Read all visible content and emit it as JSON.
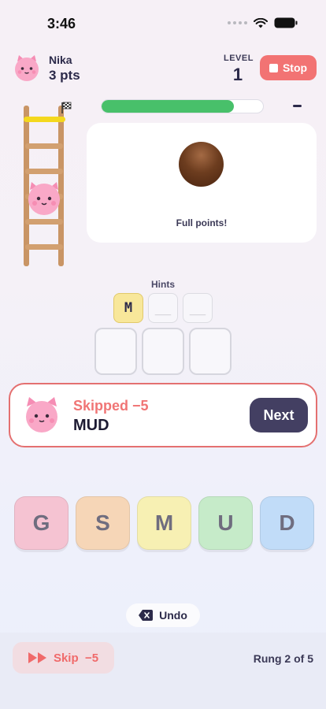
{
  "status_bar": {
    "time": "3:46"
  },
  "player": {
    "name": "Nika",
    "points": "3 pts"
  },
  "level": {
    "label": "LEVEL",
    "value": "1"
  },
  "stop_button": {
    "label": "Stop"
  },
  "progress": {
    "fraction": 0.82,
    "fill_color": "#48c06a"
  },
  "clue": {
    "text": "Full points!"
  },
  "hints": {
    "label": "Hints",
    "tiles": [
      {
        "char": "M",
        "revealed": true
      },
      {
        "char": "__",
        "revealed": false
      },
      {
        "char": "__",
        "revealed": false
      }
    ]
  },
  "answer_slots": 3,
  "result": {
    "title": "Skipped −5",
    "word": "MUD",
    "next_label": "Next"
  },
  "letters": [
    {
      "char": "G",
      "color": "#f5c3d2"
    },
    {
      "char": "S",
      "color": "#f6d6b7"
    },
    {
      "char": "M",
      "color": "#f7f0b3"
    },
    {
      "char": "U",
      "color": "#c6ebc9"
    },
    {
      "char": "D",
      "color": "#c1dcf8"
    }
  ],
  "undo": {
    "label": "Undo"
  },
  "skip": {
    "label": "Skip  −5"
  },
  "rung": {
    "text": "Rung 2 of 5"
  },
  "colors": {
    "accent": "#f27373",
    "dark": "#433f62",
    "pink_cat": "#f7a6c4"
  }
}
